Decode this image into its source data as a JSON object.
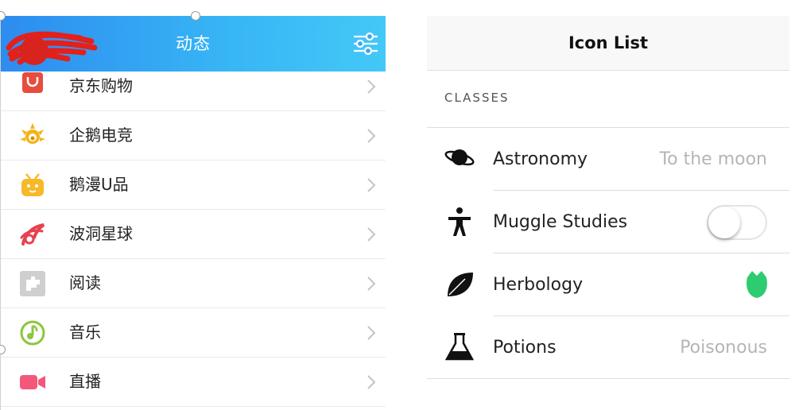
{
  "left_app": {
    "title": "动态",
    "menu": [
      {
        "label": "京东购物",
        "icon": "shopping-bag-icon",
        "color": "#e74c3c"
      },
      {
        "label": "企鹅电竞",
        "icon": "penguin-esports-icon",
        "color": "#f2b418"
      },
      {
        "label": "鹅漫U品",
        "icon": "tv-mascot-icon",
        "color": "#f7b928"
      },
      {
        "label": "波洞星球",
        "icon": "planet-swirl-icon",
        "color": "#e8414f"
      },
      {
        "label": "阅读",
        "icon": "puzzle-icon",
        "color": "#c8c8c8"
      },
      {
        "label": "音乐",
        "icon": "music-note-icon",
        "color": "#8cc63f"
      },
      {
        "label": "直播",
        "icon": "video-camera-icon",
        "color": "#f5577a"
      }
    ],
    "header_colors": [
      "#2d8cf0",
      "#44c8f7"
    ]
  },
  "right_app": {
    "title": "Icon List",
    "section": "CLASSES",
    "items": [
      {
        "label": "Astronomy",
        "icon": "planet-icon",
        "note": "To the moon"
      },
      {
        "label": "Muggle Studies",
        "icon": "person-icon",
        "toggle_on": false
      },
      {
        "label": "Herbology",
        "icon": "leaf-icon",
        "accessory_icon": "rose-icon",
        "accessory_color": "#2ecc71"
      },
      {
        "label": "Potions",
        "icon": "flask-icon",
        "note": "Poisonous"
      }
    ]
  }
}
